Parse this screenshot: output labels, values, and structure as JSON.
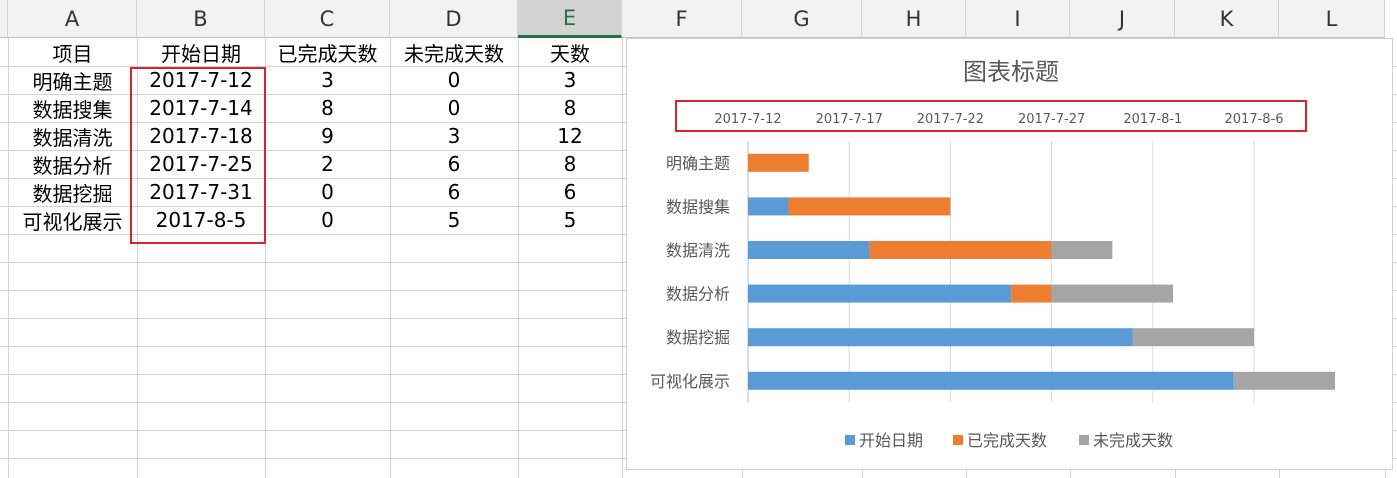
{
  "columns": [
    "A",
    "B",
    "C",
    "D",
    "E",
    "F",
    "G",
    "H",
    "I",
    "J",
    "K",
    "L"
  ],
  "selected_column": "E",
  "table": {
    "headers": [
      "项目",
      "开始日期",
      "已完成天数",
      "未完成天数",
      "天数"
    ],
    "rows": [
      [
        "明确主题",
        "2017-7-12",
        "3",
        "0",
        "3"
      ],
      [
        "数据搜集",
        "2017-7-14",
        "8",
        "0",
        "8"
      ],
      [
        "数据清洗",
        "2017-7-18",
        "9",
        "3",
        "12"
      ],
      [
        "数据分析",
        "2017-7-25",
        "2",
        "6",
        "8"
      ],
      [
        "数据挖掘",
        "2017-7-31",
        "0",
        "6",
        "6"
      ],
      [
        "可视化展示",
        "2017-8-5",
        "0",
        "5",
        "5"
      ]
    ]
  },
  "colors": {
    "grid": "#d4d4d4",
    "header_bg": "#f2f2f2",
    "selected_header": "#217346",
    "highlight_box": "#d9242d",
    "series_start": "#5b9bd5",
    "series_done": "#ed7d31",
    "series_todo": "#a5a5a5"
  },
  "chart_data": {
    "type": "bar",
    "orientation": "horizontal",
    "stacked": true,
    "title": "图表标题",
    "categories": [
      "明确主题",
      "数据搜集",
      "数据清洗",
      "数据分析",
      "数据挖掘",
      "可视化展示"
    ],
    "x_axis_position": "top",
    "x_ticks": [
      "2017-7-12",
      "2017-7-17",
      "2017-7-22",
      "2017-7-27",
      "2017-8-1",
      "2017-8-6"
    ],
    "x_tick_dates": [
      "2017-07-12",
      "2017-07-17",
      "2017-07-22",
      "2017-07-27",
      "2017-08-01",
      "2017-08-06"
    ],
    "xlim": [
      "2017-07-12",
      "2017-08-10"
    ],
    "series": [
      {
        "name": "开始日期",
        "color": "#5b9bd5",
        "values": [
          "2017-07-12",
          "2017-07-14",
          "2017-07-18",
          "2017-07-25",
          "2017-07-31",
          "2017-08-05"
        ]
      },
      {
        "name": "已完成天数",
        "color": "#ed7d31",
        "values": [
          3,
          8,
          9,
          2,
          0,
          0
        ]
      },
      {
        "name": "未完成天数",
        "color": "#a5a5a5",
        "values": [
          0,
          0,
          3,
          6,
          6,
          5
        ]
      }
    ],
    "grid": true,
    "legend_position": "bottom"
  }
}
